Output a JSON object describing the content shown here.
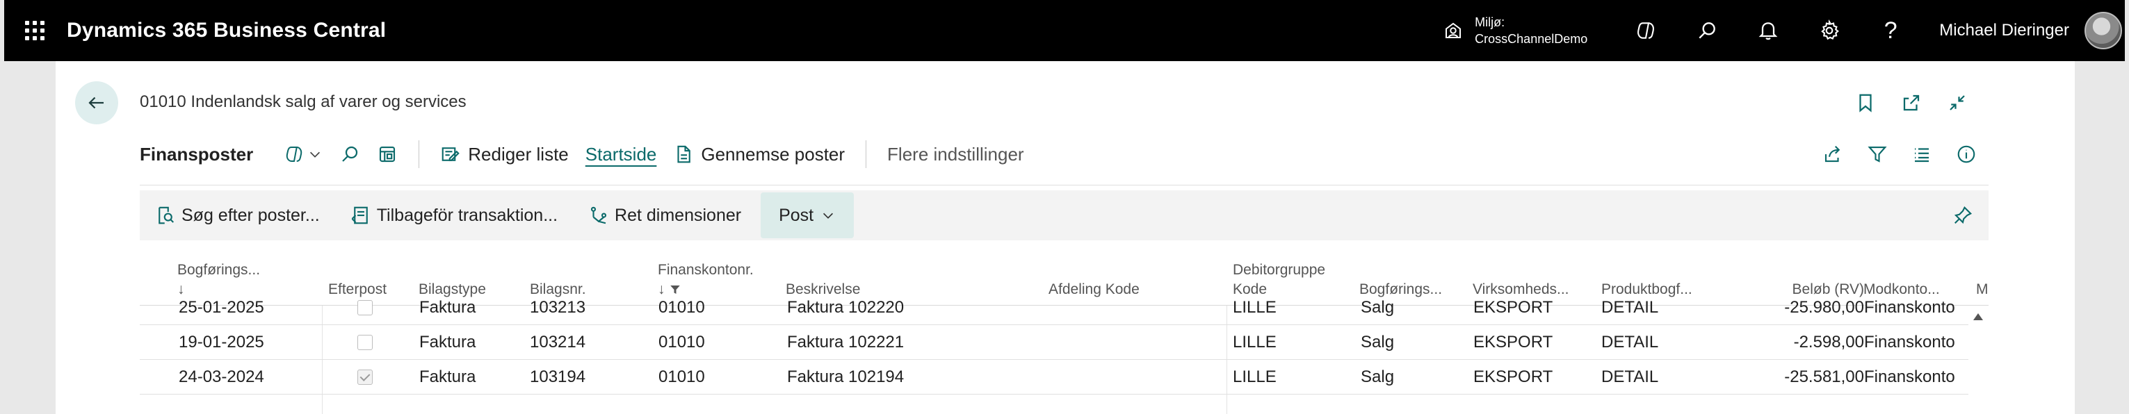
{
  "appbar": {
    "title": "Dynamics 365 Business Central",
    "environment_label": "Miljø:",
    "environment_value": "CrossChannelDemo",
    "help_glyph": "?",
    "user_name": "Michael Dieringer"
  },
  "page": {
    "title": "01010 Indenlandsk salg af varer og services"
  },
  "actionbar": {
    "caption": "Finansposter",
    "edit_list": "Rediger liste",
    "home_tab": "Startside",
    "browse_entries": "Gennemse poster",
    "more_options": "Flere indstillinger"
  },
  "promoted": {
    "find_entries": "Søg efter poster...",
    "reverse_transaction": "Tilbageför transaktion...",
    "set_dimensions": "Ret dimensioner",
    "post": "Post"
  },
  "grid": {
    "columns": {
      "posting_date": "Bogførings...",
      "posting_date_sort": "↓",
      "efterpost": "Efterpost",
      "doc_type": "Bilagstype",
      "doc_no": "Bilagsnr.",
      "gl_account_line1": "Finanskontonr.",
      "gl_account_sort": "↓",
      "description": "Beskrivelse",
      "department": "Afdeling Kode",
      "customer_group_line1": "Debitorgruppe",
      "customer_group_line2": "Kode",
      "posting_type": "Bogførings...",
      "business_posting": "Virksomheds...",
      "product_posting": "Produktbogf...",
      "amount": "Beløb (RV)",
      "bal_account_type": "Modkonto...",
      "bal_account": "Modkonto"
    },
    "rows": [
      {
        "date": "25-01-2025",
        "efterpost": false,
        "type": "Faktura",
        "doc": "103213",
        "account": "01010",
        "desc": "Faktura 102220",
        "dept": "",
        "custgrp": "LILLE",
        "ptype": "Salg",
        "bus": "EKSPORT",
        "prod": "DETAIL",
        "amount": "-25.980,00",
        "baltype": "Finanskonto"
      },
      {
        "date": "19-01-2025",
        "efterpost": false,
        "type": "Faktura",
        "doc": "103214",
        "account": "01010",
        "desc": "Faktura 102221",
        "dept": "",
        "custgrp": "LILLE",
        "ptype": "Salg",
        "bus": "EKSPORT",
        "prod": "DETAIL",
        "amount": "-2.598,00",
        "baltype": "Finanskonto"
      },
      {
        "date": "24-03-2024",
        "efterpost": true,
        "type": "Faktura",
        "doc": "103194",
        "account": "01010",
        "desc": "Faktura 102194",
        "dept": "",
        "custgrp": "LILLE",
        "ptype": "Salg",
        "bus": "EKSPORT",
        "prod": "DETAIL",
        "amount": "-25.581,00",
        "baltype": "Finanskonto"
      }
    ]
  },
  "icons": {
    "waffle": "app-launcher-icon",
    "environment": "environment-icon",
    "copilot": "copilot-icon",
    "search": "search-icon",
    "bell": "bell-icon",
    "settings": "gear-icon",
    "help": "help-icon",
    "back": "back-arrow-icon",
    "bookmark": "bookmark-icon",
    "open_new": "open-in-new-window-icon",
    "collapse": "collapse-icon",
    "share": "share-icon",
    "filter": "filter-icon",
    "list": "list-view-icon",
    "info": "info-icon",
    "pin": "pin-icon"
  },
  "colors": {
    "appbar_bg": "#000000",
    "accent": "#0b6a6a",
    "back_button_bg": "#dfeeee",
    "post_button_bg": "#dcecea"
  }
}
